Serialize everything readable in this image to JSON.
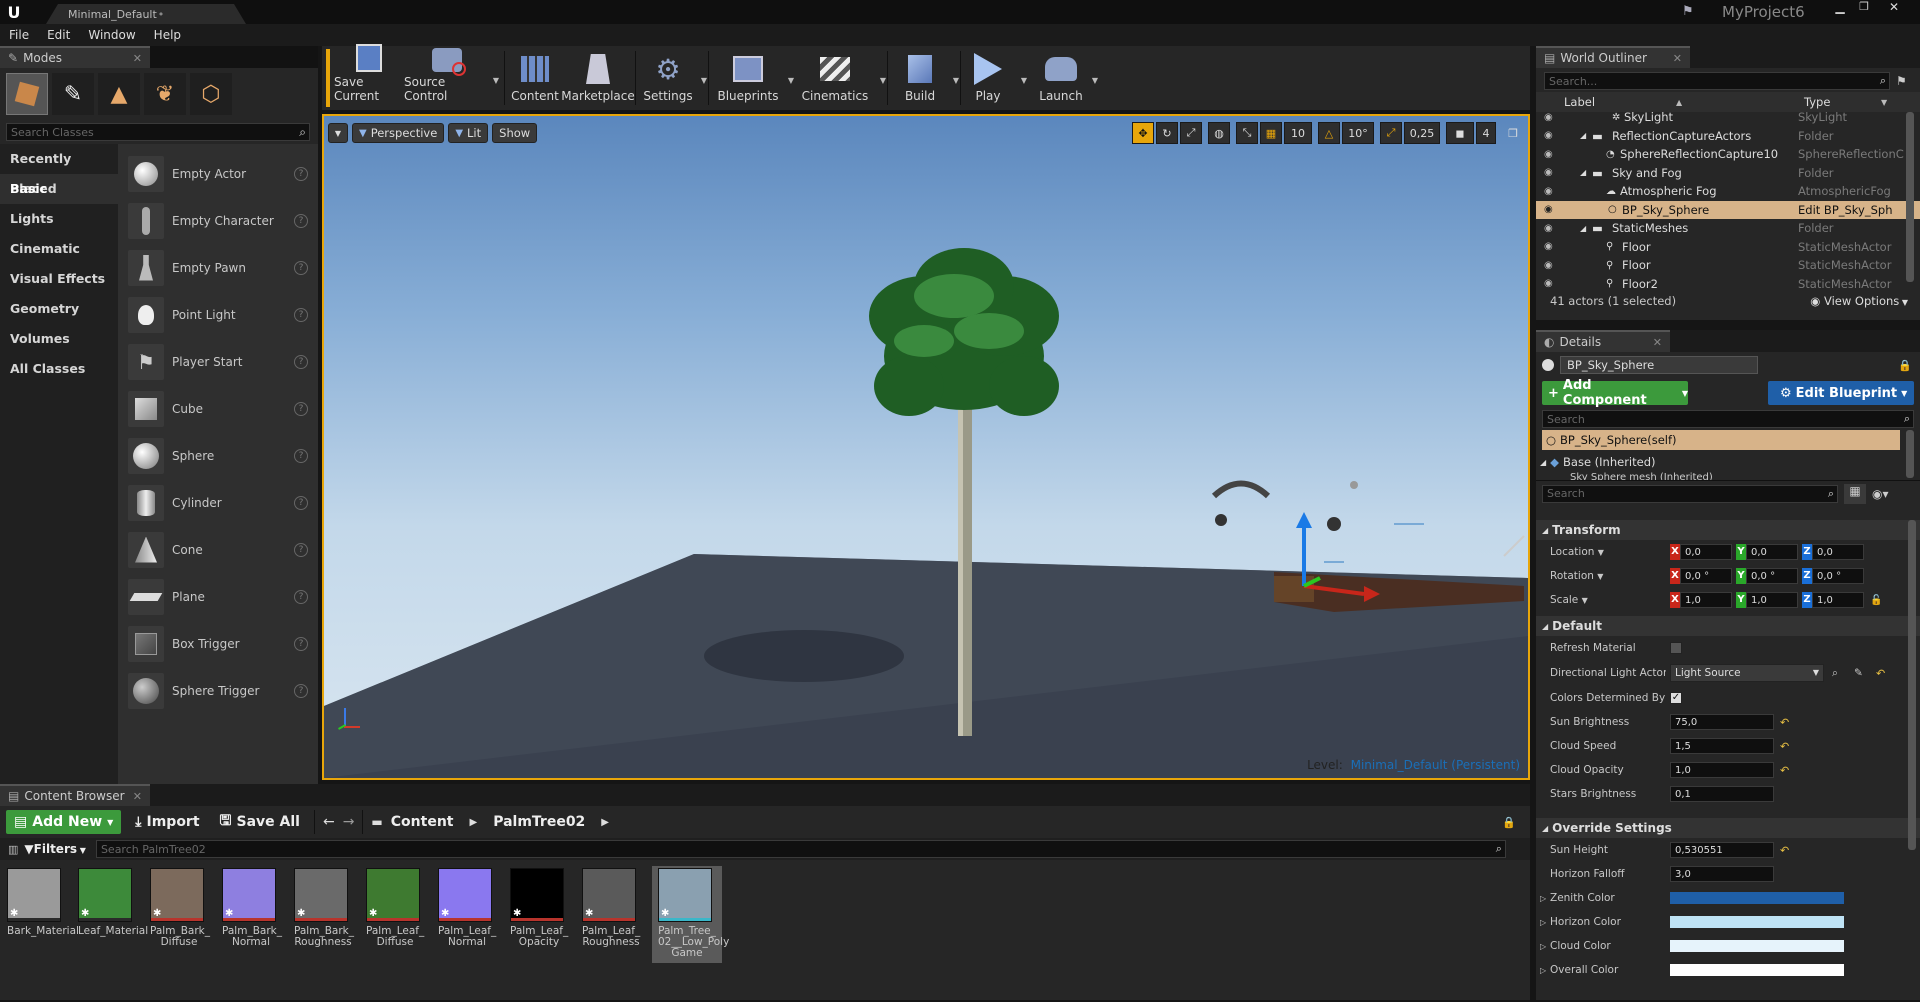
{
  "title_bar": {
    "tab_name": "Minimal_Default",
    "project_name": "MyProject6"
  },
  "menu": {
    "items": [
      "File",
      "Edit",
      "Window",
      "Help"
    ]
  },
  "modes": {
    "tab_label": "Modes",
    "search_placeholder": "Search Classes",
    "categories": [
      "Recently Placed",
      "Basic",
      "Lights",
      "Cinematic",
      "Visual Effects",
      "Geometry",
      "Volumes",
      "All Classes"
    ],
    "selected_category": "Basic",
    "items": [
      "Empty Actor",
      "Empty Character",
      "Empty Pawn",
      "Point Light",
      "Player Start",
      "Cube",
      "Sphere",
      "Cylinder",
      "Cone",
      "Plane",
      "Box Trigger",
      "Sphere Trigger"
    ]
  },
  "toolbar": {
    "buttons": [
      "Save Current",
      "Source Control",
      "Content",
      "Marketplace",
      "Settings",
      "Blueprints",
      "Cinematics",
      "Build",
      "Play",
      "Launch"
    ]
  },
  "viewport": {
    "perspective_label": "Perspective",
    "lit_label": "Lit",
    "show_label": "Show",
    "grid_snap": "10",
    "rotation_snap": "10°",
    "scale_snap": "0,25",
    "camera_speed": "4",
    "level_prefix": "Level:",
    "level_name": "Minimal_Default (Persistent)"
  },
  "outliner": {
    "tab_label": "World Outliner",
    "search_placeholder": "Search...",
    "col_label": "Label",
    "col_type": "Type",
    "rows": [
      {
        "label": "SkyLight",
        "type": "SkyLight"
      },
      {
        "label": "ReflectionCaptureActors",
        "type": "Folder"
      },
      {
        "label": "SphereReflectionCapture10",
        "type": "SphereReflectionC"
      },
      {
        "label": "Sky and Fog",
        "type": "Folder"
      },
      {
        "label": "Atmospheric Fog",
        "type": "AtmosphericFog"
      },
      {
        "label": "BP_Sky_Sphere",
        "type": "Edit BP_Sky_Sph"
      },
      {
        "label": "StaticMeshes",
        "type": "Folder"
      },
      {
        "label": "Floor",
        "type": "StaticMeshActor"
      },
      {
        "label": "Floor",
        "type": "StaticMeshActor"
      },
      {
        "label": "Floor2",
        "type": "StaticMeshActor"
      }
    ],
    "status": "41 actors (1 selected)",
    "view_options": "View Options"
  },
  "details": {
    "tab_label": "Details",
    "actor_name": "BP_Sky_Sphere",
    "add_component": "Add Component",
    "edit_blueprint": "Edit Blueprint",
    "search_placeholder": "Search",
    "self_label": "BP_Sky_Sphere(self)",
    "base_label": "Base (Inherited)",
    "sub_label": "Sky Sphere mesh (Inherited)",
    "search2_placeholder": "Search",
    "transform_title": "Transform",
    "location_label": "Location",
    "rotation_label": "Rotation",
    "scale_label": "Scale",
    "location": [
      "0,0",
      "0,0",
      "0,0"
    ],
    "rotation": [
      "0,0 °",
      "0,0 °",
      "0,0 °"
    ],
    "scale": [
      "1,0",
      "1,0",
      "1,0"
    ],
    "default_title": "Default",
    "refresh_material": "Refresh Material",
    "directional_light_actor": "Directional Light Actor",
    "light_source": "Light Source",
    "colors_determined_by": "Colors Determined By",
    "sun_brightness_label": "Sun Brightness",
    "sun_brightness": "75,0",
    "cloud_speed_label": "Cloud Speed",
    "cloud_speed": "1,5",
    "cloud_opacity_label": "Cloud Opacity",
    "cloud_opacity": "1,0",
    "stars_brightness_label": "Stars Brightness",
    "stars_brightness": "0,1",
    "override_title": "Override Settings",
    "sun_height_label": "Sun Height",
    "sun_height": "0,530551",
    "horizon_falloff_label": "Horizon Falloff",
    "horizon_falloff": "3,0",
    "zenith_color_label": "Zenith Color",
    "zenith_color": "#1f5fa8",
    "horizon_color_label": "Horizon Color",
    "horizon_color": "#bfe3f5",
    "cloud_color_label": "Cloud Color",
    "cloud_color": "#e6f3fb",
    "overall_color_label": "Overall Color",
    "overall_color": "#ffffff"
  },
  "content_browser": {
    "tab_label": "Content Browser",
    "add_new": "Add New",
    "import": "Import",
    "save_all": "Save All",
    "path": [
      "Content",
      "PalmTree02"
    ],
    "filters": "Filters",
    "search_placeholder": "Search PalmTree02",
    "assets": [
      {
        "label": "Bark_Material",
        "color": "#9a9a9a",
        "bar": "#2a2a2a"
      },
      {
        "label": "Leaf_Material",
        "color": "#3d8a3a",
        "bar": "#2a2a2a"
      },
      {
        "label": "Palm_Bark_\nDiffuse",
        "color": "#7c6a5c",
        "bar": "#b8342c"
      },
      {
        "label": "Palm_Bark_\nNormal",
        "color": "#8e7fe0",
        "bar": "#b8342c"
      },
      {
        "label": "Palm_Bark_\nRoughness",
        "color": "#6a6a6a",
        "bar": "#b8342c"
      },
      {
        "label": "Palm_Leaf_\nDiffuse",
        "color": "#3e7a30",
        "bar": "#b8342c"
      },
      {
        "label": "Palm_Leaf_\nNormal",
        "color": "#8a78ef",
        "bar": "#b8342c"
      },
      {
        "label": "Palm_Leaf_\nOpacity",
        "color": "#000000",
        "bar": "#b8342c"
      },
      {
        "label": "Palm_Leaf_\nRoughness",
        "color": "#5a5a5a",
        "bar": "#b8342c"
      },
      {
        "label": "Palm_Tree_\n02__Low_Poly\nGame",
        "color": "#8aa0b0",
        "bar": "#3ab7c9"
      }
    ]
  },
  "colors": {
    "accent": "#e8a60a",
    "add_green": "#3c9a3c",
    "edit_blue": "#1f5fa8",
    "selected_row": "#d7b389"
  }
}
